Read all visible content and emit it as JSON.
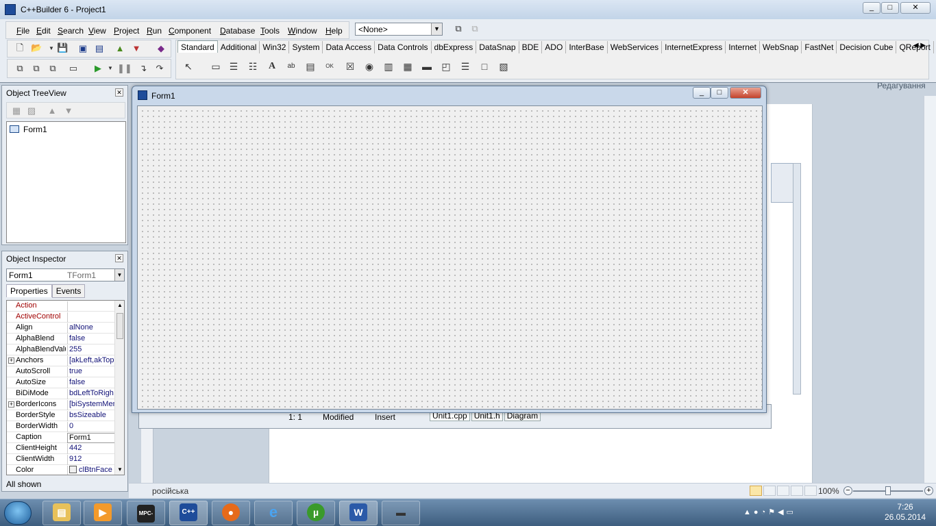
{
  "ide": {
    "title": "C++Builder 6 - Project1",
    "menu": [
      "File",
      "Edit",
      "Search",
      "View",
      "Project",
      "Run",
      "Component",
      "Database",
      "Tools",
      "Window",
      "Help"
    ],
    "config_combo": "<None>",
    "palette_tabs": [
      "Standard",
      "Additional",
      "Win32",
      "System",
      "Data Access",
      "Data Controls",
      "dbExpress",
      "DataSnap",
      "BDE",
      "ADO",
      "InterBase",
      "WebServices",
      "InternetExpress",
      "Internet",
      "WebSnap",
      "FastNet",
      "Decision Cube",
      "QReport"
    ],
    "active_tab": "Standard"
  },
  "treeview": {
    "title": "Object TreeView",
    "item": "Form1"
  },
  "inspector": {
    "title": "Object Inspector",
    "object_name": "Form1",
    "object_type": "TForm1",
    "tabs": [
      "Properties",
      "Events"
    ],
    "properties": [
      {
        "name": "Action",
        "value": ""
      },
      {
        "name": "ActiveControl",
        "value": ""
      },
      {
        "name": "Align",
        "value": "alNone"
      },
      {
        "name": "AlphaBlend",
        "value": "false"
      },
      {
        "name": "AlphaBlendValu",
        "value": "255"
      },
      {
        "name": "Anchors",
        "value": "[akLeft,akTop"
      },
      {
        "name": "AutoScroll",
        "value": "true"
      },
      {
        "name": "AutoSize",
        "value": "false"
      },
      {
        "name": "BiDiMode",
        "value": "bdLeftToRigh"
      },
      {
        "name": "BorderIcons",
        "value": "[biSystemMen"
      },
      {
        "name": "BorderStyle",
        "value": "bsSizeable"
      },
      {
        "name": "BorderWidth",
        "value": "0"
      },
      {
        "name": "Caption",
        "value": "Form1"
      },
      {
        "name": "ClientHeight",
        "value": "442"
      },
      {
        "name": "ClientWidth",
        "value": "912"
      },
      {
        "name": "Color",
        "value": "clBtnFace"
      }
    ],
    "status": "All shown"
  },
  "form1": {
    "title": "Form1"
  },
  "editor": {
    "position": "1:   1",
    "modified": "Modified",
    "mode": "Insert",
    "tabs": [
      "Unit1.cpp",
      "Unit1.h",
      "Diagram"
    ]
  },
  "word": {
    "ribbon_label": "Редагування",
    "language": "російська",
    "zoom": "100%"
  },
  "taskbar": {
    "time": "7:26",
    "date": "26.05.2014",
    "apps": [
      "MPC-BE",
      "C++Builder",
      "Firefox",
      "Internet Explorer",
      "uTorrent",
      "Word",
      "Tanks"
    ]
  }
}
